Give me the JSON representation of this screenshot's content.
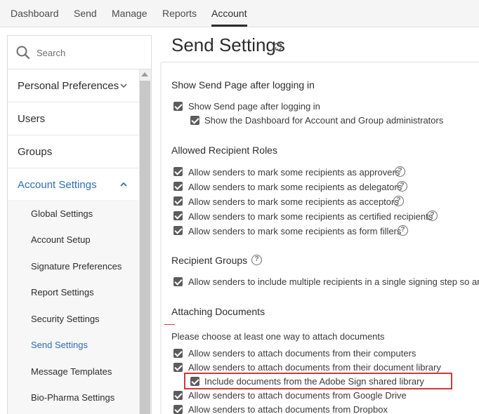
{
  "topnav": {
    "tabs": [
      "Dashboard",
      "Send",
      "Manage",
      "Reports",
      "Account"
    ],
    "active": "Account"
  },
  "sidebar": {
    "search_placeholder": "Search",
    "items": [
      {
        "label": "Personal Preferences",
        "chevron": "down"
      },
      {
        "label": "Users"
      },
      {
        "label": "Groups"
      },
      {
        "label": "Account Settings",
        "chevron": "up",
        "active": true
      }
    ],
    "sub_items": [
      "Global Settings",
      "Account Setup",
      "Signature Preferences",
      "Report Settings",
      "Security Settings",
      "Send Settings",
      "Message Templates",
      "Bio-Pharma Settings"
    ],
    "active_sub": "Send Settings"
  },
  "main": {
    "title": "Send Settings",
    "sections": {
      "send_page": {
        "heading": "Show Send Page after logging in",
        "opt1": "Show Send page after logging in",
        "opt2": "Show the Dashboard for Account and Group administrators"
      },
      "roles": {
        "heading": "Allowed Recipient Roles",
        "opt1": "Allow senders to mark some recipients as approvers",
        "opt2": "Allow senders to mark some recipients as delegators",
        "opt3": "Allow senders to mark some recipients as acceptors",
        "opt4": "Allow senders to mark some recipients as certified recipients",
        "opt5": "Allow senders to mark some recipients as form fillers"
      },
      "groups": {
        "heading": "Recipient Groups",
        "opt1": "Allow senders to include multiple recipients in a single signing step so any o"
      },
      "attach": {
        "heading": "Attaching Documents",
        "note": "Please choose at least one way to attach documents",
        "opt1": "Allow senders to attach documents from their computers",
        "opt2": "Allow senders to attach documents from their document library",
        "opt3": "Include documents from the Adobe Sign shared library",
        "opt4": "Allow senders to attach documents from Google Drive",
        "opt5": "Allow senders to attach documents from Dropbox"
      }
    }
  },
  "colors": {
    "accent": "#2d6fb7",
    "highlight_border": "#d03838",
    "checkbox": "#5c5c5c"
  }
}
